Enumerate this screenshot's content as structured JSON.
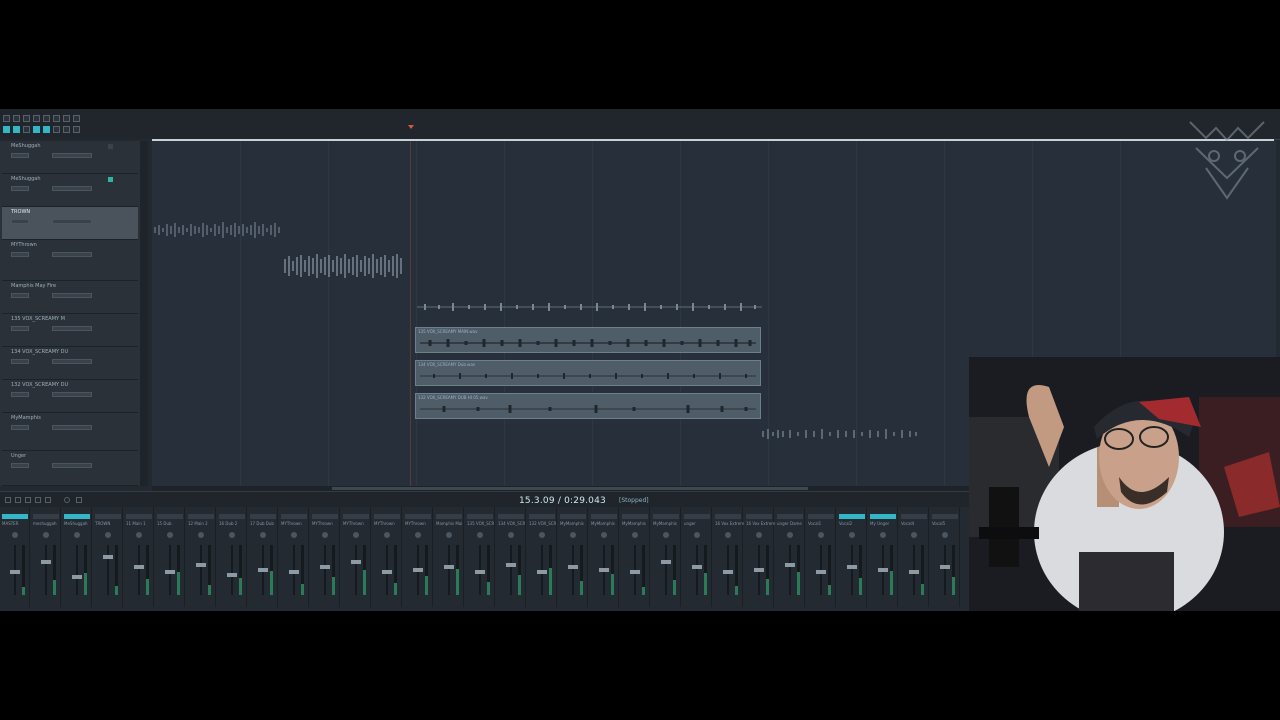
{
  "transport": {
    "time_display": "15.3.09 / 0:29.043",
    "status": "[Stopped]"
  },
  "tracks": [
    {
      "name": "MeShuggah",
      "selected": false
    },
    {
      "name": "MeShuggah",
      "selected": false
    },
    {
      "name": "TROWN",
      "selected": true
    },
    {
      "name": "MYThrown",
      "selected": false
    },
    {
      "name": "Mamphis May Fire",
      "selected": false
    },
    {
      "name": "135 VOX_SCREAMY M",
      "selected": false
    },
    {
      "name": "134 VOX_SCREAMY DU",
      "selected": false
    },
    {
      "name": "132 VOX_SCREAMY DU",
      "selected": false
    },
    {
      "name": "MyMamphis",
      "selected": false
    },
    {
      "name": "Unger",
      "selected": false
    }
  ],
  "clips": [
    {
      "label": "135 VOX_SCREAMY MAIN.wav"
    },
    {
      "label": "134 VOX_SCREAMY Dub.wav"
    },
    {
      "label": "132 VOX_SCREAMY DUB HI 05.wav"
    }
  ],
  "mixer_strips": [
    "MASTER",
    "meshuggah",
    "MeShuggah",
    "TROWN",
    "11 Main 1",
    "15 Dub",
    "12 Main 2",
    "16 Dub 2",
    "17 Dub Dub",
    "MYThrown",
    "MYThrown",
    "MYThrown",
    "MYThrown",
    "MYThrown",
    "Mamphis Mai",
    "135 VOX_SCR",
    "134 VOX_SCR",
    "132 VOX_SCR",
    "MyMamphis",
    "MyMamphis",
    "MyMamphis",
    "MyMamphis",
    "unger",
    "16 Vox Extrem",
    "16 Vox Extrem",
    "unger Dame",
    "Vocal1",
    "Vocal2",
    "My Unger",
    "Vocal4",
    "Vocal5"
  ],
  "colors": {
    "accent": "#35b6c6",
    "background": "#222930"
  }
}
